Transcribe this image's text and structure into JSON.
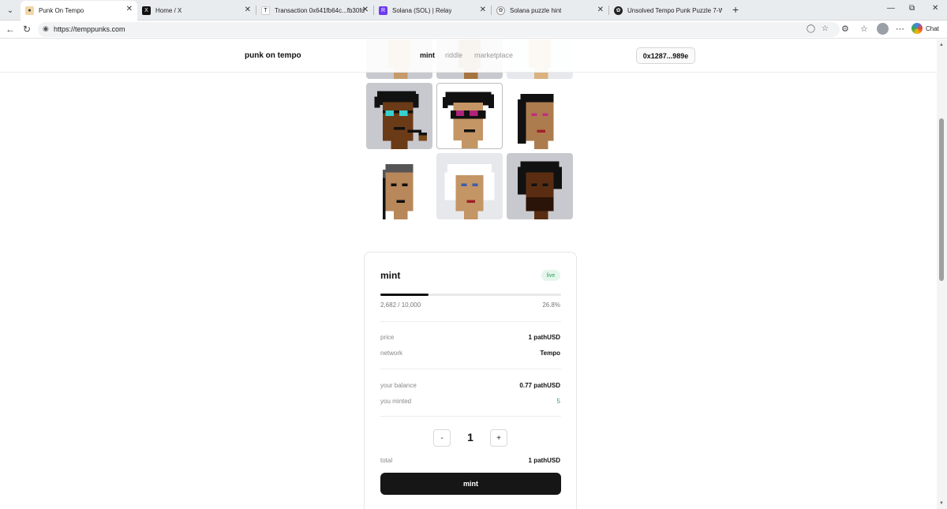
{
  "browser": {
    "tabs": [
      {
        "title": "Punk On Tempo",
        "active": true,
        "favicon": "punk-favicon",
        "color": "#f0d7a8"
      },
      {
        "title": "Home / X",
        "active": false,
        "favicon": "x-icon",
        "color": "#111111"
      },
      {
        "title": "Transaction 0x641fb64c...fb30fd · T",
        "active": false,
        "favicon": "tempo-icon",
        "color": "#222222"
      },
      {
        "title": "Solana (SOL) | Relay",
        "active": false,
        "favicon": "relay-icon",
        "color": "#6e3cf0"
      },
      {
        "title": "Solana puzzle hint",
        "active": false,
        "favicon": "chatgpt-icon",
        "color": "#555555"
      },
      {
        "title": "Unsolved Tempo Punk Puzzle 7-W",
        "active": false,
        "favicon": "chatgpt-icon",
        "color": "#222222"
      }
    ],
    "url": "https://temppunks.com",
    "chat_label": "Chat"
  },
  "site": {
    "brand": "punk on tempo",
    "nav": [
      "mint",
      "riddle",
      "marketplace"
    ],
    "wallet": "0x1287...989e"
  },
  "mint": {
    "title": "mint",
    "status": "live",
    "minted": "2,682 / 10,000",
    "percent": "26.8%",
    "progress": 0.268,
    "rows": [
      {
        "label": "price",
        "value": "1 pathUSD"
      },
      {
        "label": "network",
        "value": "Tempo"
      },
      {
        "label": "your balance",
        "value": "0.77 pathUSD"
      },
      {
        "label": "you minted",
        "value": "5"
      }
    ],
    "quantity": "1",
    "decrement": "-",
    "increment": "+",
    "total_label": "total",
    "total_value": "1 pathUSD",
    "button": "mint"
  },
  "colors": {
    "accent": "#161616",
    "live_green": "#2e9e63"
  }
}
